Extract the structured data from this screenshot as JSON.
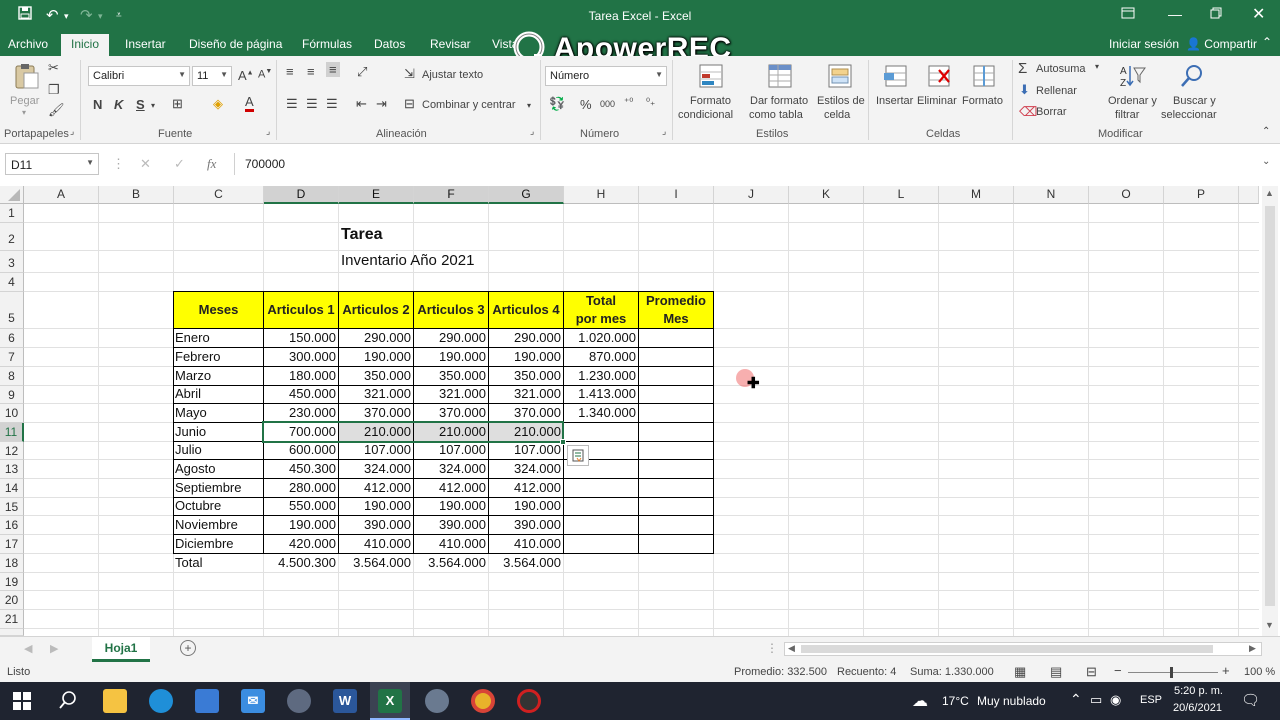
{
  "titlebar": {
    "title": "Tarea Excel - Excel"
  },
  "tabs": [
    "Archivo",
    "Inicio",
    "Insertar",
    "Diseño de página",
    "Fórmulas",
    "Datos",
    "Revisar",
    "Vista"
  ],
  "account": {
    "signin": "Iniciar sesión",
    "share": "Compartir"
  },
  "watermark": "ApowerREC",
  "ribbon": {
    "paste": "Pegar",
    "font_name": "Calibri",
    "font_size": "11",
    "wrap_text": "Ajustar texto",
    "merge_center": "Combinar y centrar",
    "number_format": "Número",
    "percent": "%",
    "thousands": "000",
    "conditional_format": [
      "Formato",
      "condicional"
    ],
    "format_table": [
      "Dar formato",
      "como tabla"
    ],
    "cell_styles": [
      "Estilos de",
      "celda"
    ],
    "insert": "Insertar",
    "delete": "Eliminar",
    "format": "Formato",
    "autosum": "Autosuma",
    "fill": "Rellenar",
    "clear": "Borrar",
    "sort_filter": [
      "Ordenar y",
      "filtrar"
    ],
    "find_select": [
      "Buscar y",
      "seleccionar"
    ],
    "groups": [
      "Portapapeles",
      "Fuente",
      "Alineación",
      "Número",
      "Estilos",
      "Celdas",
      "Modificar"
    ]
  },
  "formula_bar": {
    "name_box": "D11",
    "formula": "700000"
  },
  "columns": [
    "A",
    "B",
    "C",
    "D",
    "E",
    "F",
    "G",
    "H",
    "I",
    "J",
    "K",
    "L",
    "M",
    "N",
    "O",
    "P"
  ],
  "rows": [
    "1",
    "2",
    "3",
    "4",
    "5",
    "6",
    "7",
    "8",
    "9",
    "10",
    "11",
    "12",
    "13",
    "14",
    "15",
    "16",
    "17",
    "18",
    "19",
    "20",
    "21"
  ],
  "sheet": {
    "title": "Tarea",
    "subtitle": "Inventario Año 2021",
    "headers": [
      "Meses",
      "Articulos 1",
      "Articulos 2",
      "Articulos 3",
      "Articulos 4",
      "Total por mes",
      "Promedio Mes"
    ],
    "data": [
      [
        "Enero",
        "150.000",
        "290.000",
        "290.000",
        "290.000",
        "1.020.000",
        ""
      ],
      [
        "Febrero",
        "300.000",
        "190.000",
        "190.000",
        "190.000",
        "870.000",
        ""
      ],
      [
        "Marzo",
        "180.000",
        "350.000",
        "350.000",
        "350.000",
        "1.230.000",
        ""
      ],
      [
        "Abril",
        "450.000",
        "321.000",
        "321.000",
        "321.000",
        "1.413.000",
        ""
      ],
      [
        "Mayo",
        "230.000",
        "370.000",
        "370.000",
        "370.000",
        "1.340.000",
        ""
      ],
      [
        "Junio",
        "700.000",
        "210.000",
        "210.000",
        "210.000",
        "",
        ""
      ],
      [
        "Julio",
        "600.000",
        "107.000",
        "107.000",
        "107.000",
        "",
        ""
      ],
      [
        "Agosto",
        "450.300",
        "324.000",
        "324.000",
        "324.000",
        "",
        ""
      ],
      [
        "Septiembre",
        "280.000",
        "412.000",
        "412.000",
        "412.000",
        "",
        ""
      ],
      [
        "Octubre",
        "550.000",
        "190.000",
        "190.000",
        "190.000",
        "",
        ""
      ],
      [
        "Noviembre",
        "190.000",
        "390.000",
        "390.000",
        "390.000",
        "",
        ""
      ],
      [
        "Diciembre",
        "420.000",
        "410.000",
        "410.000",
        "410.000",
        "",
        ""
      ]
    ],
    "total": [
      "Total",
      "4.500.300",
      "3.564.000",
      "3.564.000",
      "3.564.000"
    ]
  },
  "sheet_tab": "Hoja1",
  "status": {
    "ready": "Listo",
    "average": "Promedio: 332.500",
    "count": "Recuento: 4",
    "sum": "Suma: 1.330.000",
    "zoom": "100 %"
  },
  "taskbar": {
    "temperature": "17°C",
    "weather": "Muy nublado",
    "lang": "ESP",
    "time": "5:20 p. m.",
    "date": "20/6/2021"
  },
  "colors": {
    "excel_green": "#217346",
    "header_yellow": "#ffff00"
  }
}
